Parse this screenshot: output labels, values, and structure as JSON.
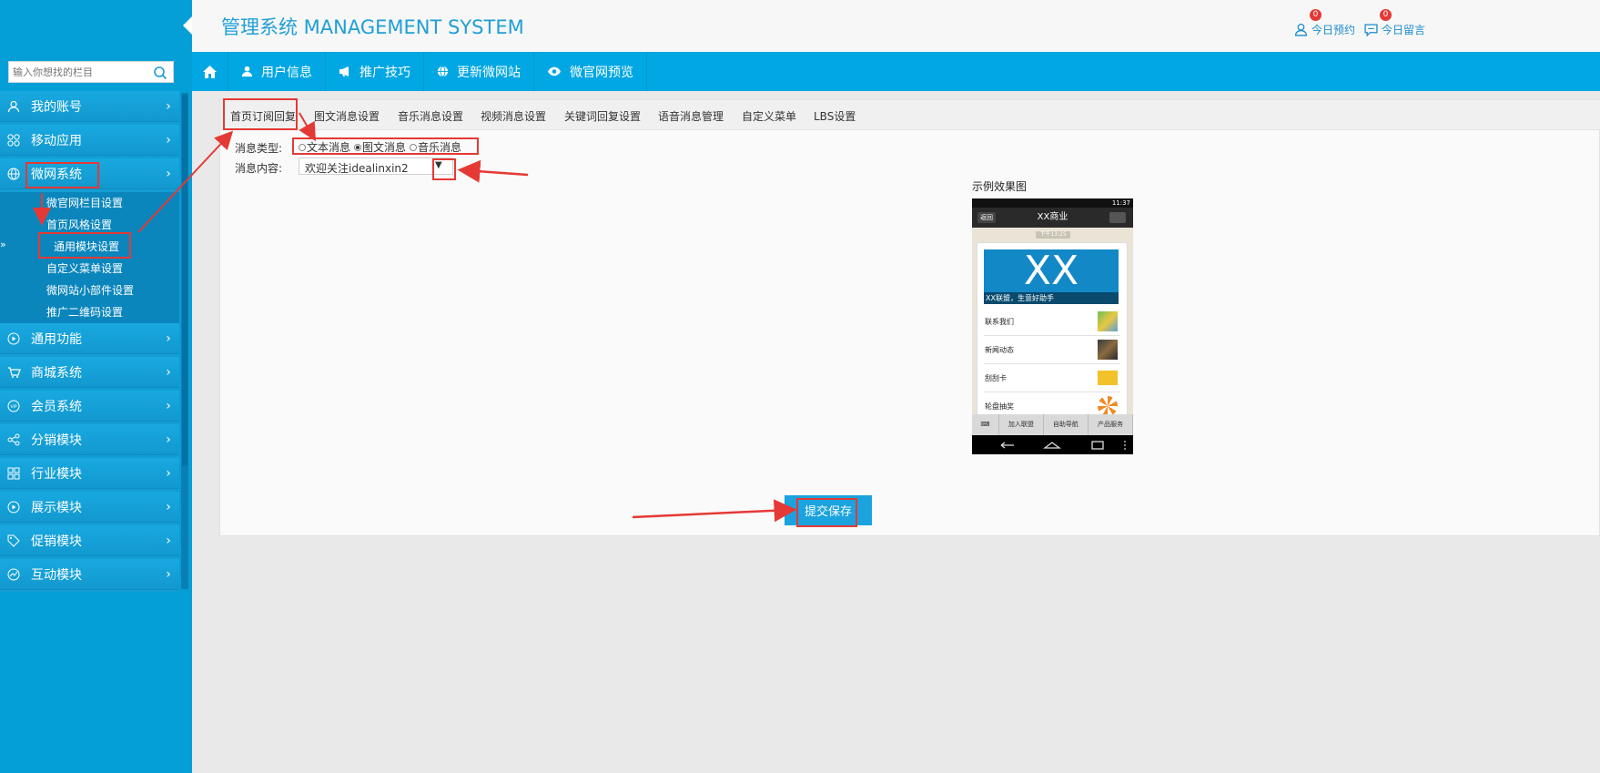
{
  "header": {
    "title": "管理系统 MANAGEMENT SYSTEM",
    "links": [
      {
        "label": "今日预约",
        "badge": "0",
        "icon": "user-icon"
      },
      {
        "label": "今日留言",
        "badge": "0",
        "icon": "message-icon"
      }
    ]
  },
  "sidebar": {
    "search_placeholder": "输入你想找的栏目",
    "items": [
      {
        "label": "我的账号",
        "icon": "user-icon"
      },
      {
        "label": "移动应用",
        "icon": "apps-icon"
      },
      {
        "label": "微网系统",
        "icon": "globe-icon"
      },
      {
        "label": "通用功能",
        "icon": "play-icon"
      },
      {
        "label": "商城系统",
        "icon": "cart-icon"
      },
      {
        "label": "会员系统",
        "icon": "vip-icon"
      },
      {
        "label": "分销模块",
        "icon": "share-icon"
      },
      {
        "label": "行业模块",
        "icon": "grid-icon"
      },
      {
        "label": "展示模块",
        "icon": "play-icon"
      },
      {
        "label": "促销模块",
        "icon": "tag-icon"
      },
      {
        "label": "互动模块",
        "icon": "chart-icon"
      }
    ],
    "submenu": [
      "微官网栏目设置",
      "首页风格设置",
      "通用模块设置",
      "自定义菜单设置",
      "微网站小部件设置",
      "推广二维码设置"
    ],
    "active_submenu_index": 2
  },
  "topnav": [
    "用户信息",
    "推广技巧",
    "更新微网站",
    "微官网预览"
  ],
  "tabs": [
    "首页订阅回复",
    "图文消息设置",
    "音乐消息设置",
    "视频消息设置",
    "关键词回复设置",
    "语音消息管理",
    "自定义菜单",
    "LBS设置"
  ],
  "form": {
    "type_label": "消息类型:",
    "options": [
      "文本消息",
      "图文消息",
      "音乐消息"
    ],
    "selected_option": 1,
    "content_label": "消息内容:",
    "content_value": "欢迎关注idealinxin2",
    "submit_label": "提交保存"
  },
  "preview": {
    "label": "示例效果图",
    "status_time": "11:37",
    "back": "返回",
    "title": "XX商业",
    "date": "下午13:25",
    "banner_text": "XX",
    "banner_caption": "XX联盟，生意好助手",
    "rows": [
      "联系我们",
      "新闻动态",
      "刮刮卡",
      "轮盘抽奖"
    ],
    "bottom_menu": [
      "加入联盟",
      "自助导航",
      "产品服务"
    ]
  },
  "colors": {
    "accent": "#00a7e3",
    "sidebar": "#059fd8",
    "highlight": "#e53935"
  }
}
